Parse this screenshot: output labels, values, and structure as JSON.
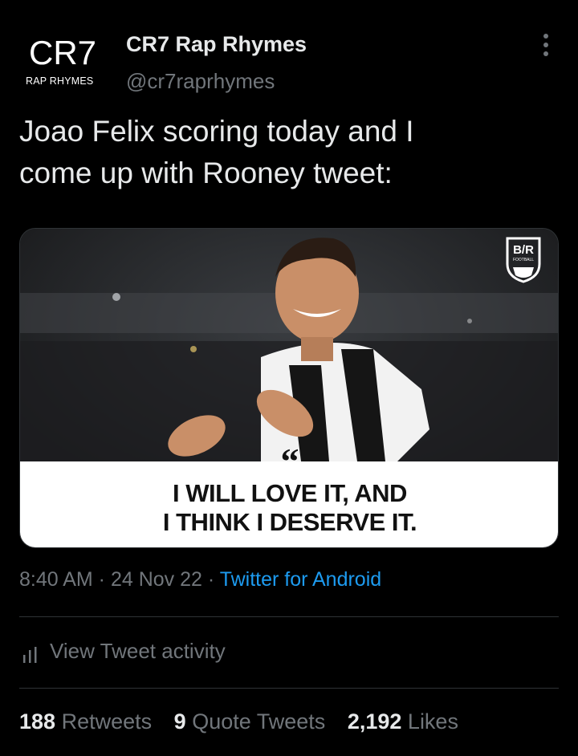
{
  "author": {
    "avatar_mark": "CR7",
    "avatar_sub": "RAP RHYMES",
    "display_name": "CR7 Rap Rhymes",
    "handle": "@cr7raprhymes"
  },
  "tweet": {
    "text_line1": "Joao Felix scoring today and I",
    "text_line2": "come up with Rooney tweet:"
  },
  "media": {
    "quote_mark": "“",
    "quote_line1": "I WILL LOVE IT, AND",
    "quote_line2": "I THINK I DESERVE IT.",
    "logo_text": "B/R",
    "logo_sub": "FOOTBALL"
  },
  "meta": {
    "time": "8:40 AM",
    "sep1": " · ",
    "date": "24 Nov 22",
    "sep2": " · ",
    "source": "Twitter for Android"
  },
  "activity": {
    "label": "View Tweet activity",
    "icon": "bar-chart-icon"
  },
  "stats": {
    "retweets_count": "188",
    "retweets_label": "Retweets",
    "quotes_count": "9",
    "quotes_label": "Quote Tweets",
    "likes_count": "2,192",
    "likes_label": "Likes"
  },
  "colors": {
    "background": "#000000",
    "text": "#e7e9ea",
    "muted": "#71767b",
    "link": "#1d9bf0",
    "divider": "#2f3336"
  }
}
